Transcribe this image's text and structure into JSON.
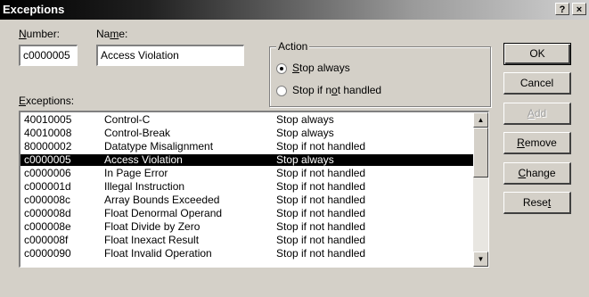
{
  "window": {
    "title": "Exceptions",
    "help_glyph": "?",
    "close_glyph": "×"
  },
  "number": {
    "label_u": "N",
    "label_rest": "umber:",
    "value": "c0000005"
  },
  "name": {
    "label_pre": "Na",
    "label_u": "m",
    "label_rest": "e:",
    "value": "Access Violation"
  },
  "action": {
    "legend": "Action",
    "opt1_u": "S",
    "opt1_rest": "top always",
    "opt2_pre": "Stop if n",
    "opt2_u": "o",
    "opt2_rest": "t handled",
    "selected": "Stop always"
  },
  "exceptions_label": {
    "label_u": "E",
    "label_rest": "xceptions:"
  },
  "rows": [
    {
      "code": "40010005",
      "name": "Control-C",
      "action": "Stop always"
    },
    {
      "code": "40010008",
      "name": "Control-Break",
      "action": "Stop always"
    },
    {
      "code": "80000002",
      "name": "Datatype Misalignment",
      "action": "Stop if not handled"
    },
    {
      "code": "c0000005",
      "name": "Access Violation",
      "action": "Stop always"
    },
    {
      "code": "c0000006",
      "name": "In Page Error",
      "action": "Stop if not handled"
    },
    {
      "code": "c000001d",
      "name": "Illegal Instruction",
      "action": "Stop if not handled"
    },
    {
      "code": "c000008c",
      "name": "Array Bounds Exceeded",
      "action": "Stop if not handled"
    },
    {
      "code": "c000008d",
      "name": "Float Denormal Operand",
      "action": "Stop if not handled"
    },
    {
      "code": "c000008e",
      "name": "Float Divide by Zero",
      "action": "Stop if not handled"
    },
    {
      "code": "c000008f",
      "name": "Float Inexact Result",
      "action": "Stop if not handled"
    },
    {
      "code": "c0000090",
      "name": "Float Invalid Operation",
      "action": "Stop if not handled"
    }
  ],
  "selected_row": "c0000005",
  "buttons": {
    "ok": "OK",
    "cancel": "Cancel",
    "add": "Add",
    "add_u": "A",
    "add_rest": "dd",
    "remove_u": "R",
    "remove_rest": "emove",
    "change_u": "C",
    "change_rest": "hange",
    "reset_pre": "Rese",
    "reset_u": "t"
  }
}
